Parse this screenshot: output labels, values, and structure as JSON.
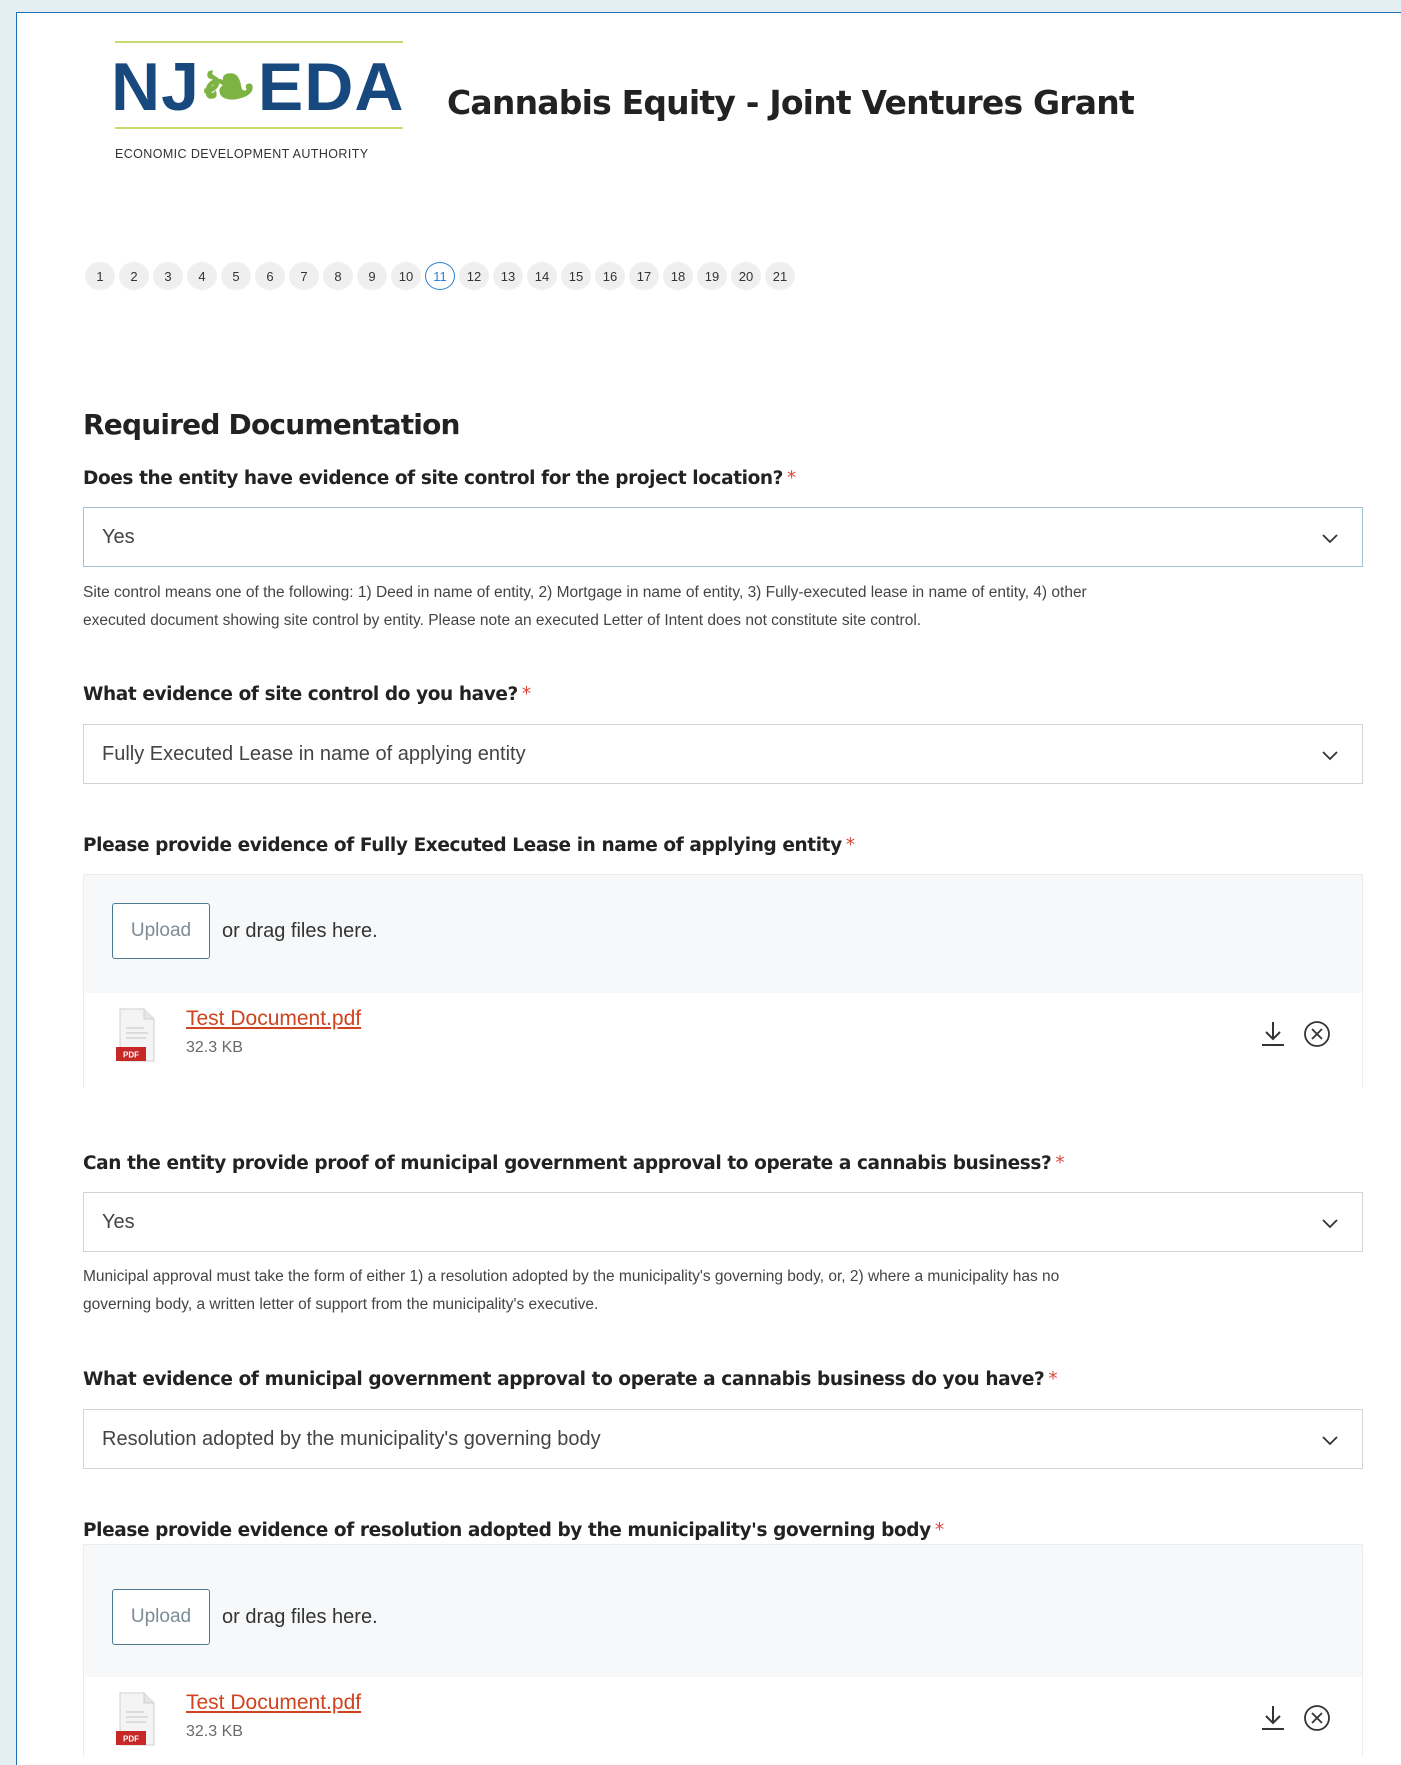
{
  "header": {
    "logo": {
      "main_left": "NJ",
      "main_leaf": "❧",
      "main_right": "EDA",
      "subtitle": "ECONOMIC DEVELOPMENT AUTHORITY"
    },
    "title": "Cannabis Equity - Joint Ventures Grant"
  },
  "stepper": {
    "current": 11,
    "steps": [
      "1",
      "2",
      "3",
      "4",
      "5",
      "6",
      "7",
      "8",
      "9",
      "10",
      "11",
      "12",
      "13",
      "14",
      "15",
      "16",
      "17",
      "18",
      "19",
      "20",
      "21"
    ]
  },
  "section": {
    "title": "Required Documentation"
  },
  "questions": {
    "q1": {
      "label": "Does the entity have evidence of site control for the project location?",
      "required_mark": "*",
      "value": "Yes",
      "help_line1": "Site control means one of the following: 1) Deed in name of entity, 2) Mortgage in name of entity, 3) Fully-executed lease in name of entity, 4) other",
      "help_line2": "executed document showing site control by entity. Please note an executed Letter of Intent does not constitute site control."
    },
    "q2": {
      "label": "What evidence of site control do you have?",
      "required_mark": "*",
      "value": "Fully Executed Lease in name of applying entity"
    },
    "q3": {
      "label": "Please provide evidence of Fully Executed Lease in name of applying entity",
      "required_mark": "*",
      "upload_label": "Upload",
      "drag_text": "or drag files here.",
      "file": {
        "name": "Test Document.pdf",
        "size": "32.3 KB",
        "icon": "pdf-file-icon"
      }
    },
    "q4": {
      "label": "Can the entity provide proof of municipal government approval to operate a cannabis business?",
      "required_mark": "*",
      "value": "Yes",
      "help_line1": "Municipal approval must take the form of either 1) a resolution adopted by the municipality's governing body, or, 2) where a municipality has no",
      "help_line2": "governing body, a written letter of support from the municipality's executive."
    },
    "q5": {
      "label": "What evidence of municipal government approval to operate a cannabis business do you have?",
      "required_mark": "*",
      "value": "Resolution adopted by the municipality's governing body"
    },
    "q6": {
      "label": "Please provide evidence of resolution adopted by the municipality's governing body",
      "required_mark": "*",
      "upload_label": "Upload",
      "drag_text": "or drag files here.",
      "file": {
        "name": "Test Document.pdf",
        "size": "32.3 KB",
        "icon": "pdf-file-icon"
      }
    }
  },
  "icons": {
    "chevron": "chevron-down-icon",
    "download": "download-icon",
    "remove": "close-circle-icon"
  },
  "colors": {
    "page_background": "#e3eff3",
    "logo_blue": "#17487e",
    "logo_green": "#7cb342",
    "required": "#d9463a",
    "file_link": "#d0431e",
    "current_step": "#2a7fd4",
    "pdf_badge": "#c62828"
  }
}
